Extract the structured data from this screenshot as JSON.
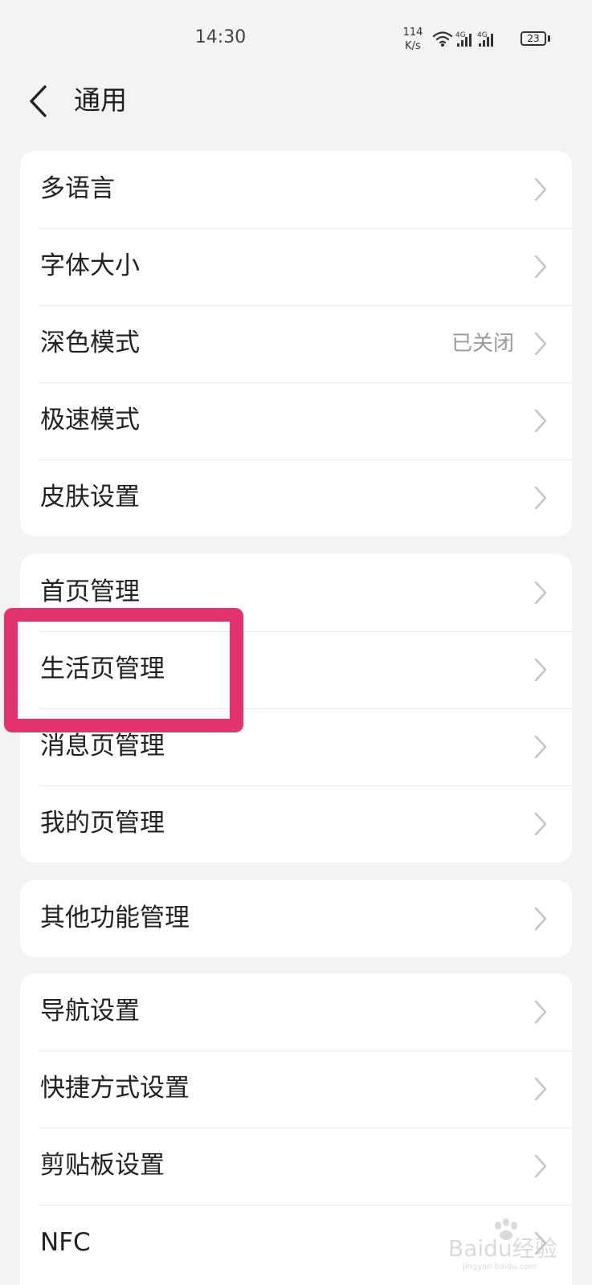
{
  "status_bar": {
    "time": "14:30",
    "net_speed_value": "114",
    "net_speed_unit": "K/s",
    "network_1": "4G",
    "network_2": "4G",
    "battery": "23",
    "icons": [
      "wifi-icon",
      "signal-icon",
      "signal-icon",
      "battery-icon"
    ]
  },
  "header": {
    "title": "通用",
    "back_icon": "chevron-left-icon"
  },
  "groups": [
    {
      "items": [
        {
          "label": "多语言",
          "value": ""
        },
        {
          "label": "字体大小",
          "value": ""
        },
        {
          "label": "深色模式",
          "value": "已关闭"
        },
        {
          "label": "极速模式",
          "value": ""
        },
        {
          "label": "皮肤设置",
          "value": ""
        }
      ]
    },
    {
      "items": [
        {
          "label": "首页管理",
          "value": ""
        },
        {
          "label": "生活页管理",
          "value": ""
        },
        {
          "label": "消息页管理",
          "value": ""
        },
        {
          "label": "我的页管理",
          "value": ""
        }
      ]
    },
    {
      "items": [
        {
          "label": "其他功能管理",
          "value": ""
        }
      ]
    },
    {
      "items": [
        {
          "label": "导航设置",
          "value": ""
        },
        {
          "label": "快捷方式设置",
          "value": ""
        },
        {
          "label": "剪贴板设置",
          "value": ""
        },
        {
          "label": "NFC",
          "value": ""
        }
      ]
    }
  ],
  "annotation": {
    "highlight_color": "#e2336e",
    "highlighted_item": "生活页管理"
  },
  "watermark": {
    "text": "Baidu经验",
    "subtext": "jingyan.baidu.com"
  },
  "colors": {
    "background": "#f3f3f3",
    "card": "#ffffff",
    "secondary_text": "#9a9a9a",
    "chevron": "#c4c4c4"
  }
}
